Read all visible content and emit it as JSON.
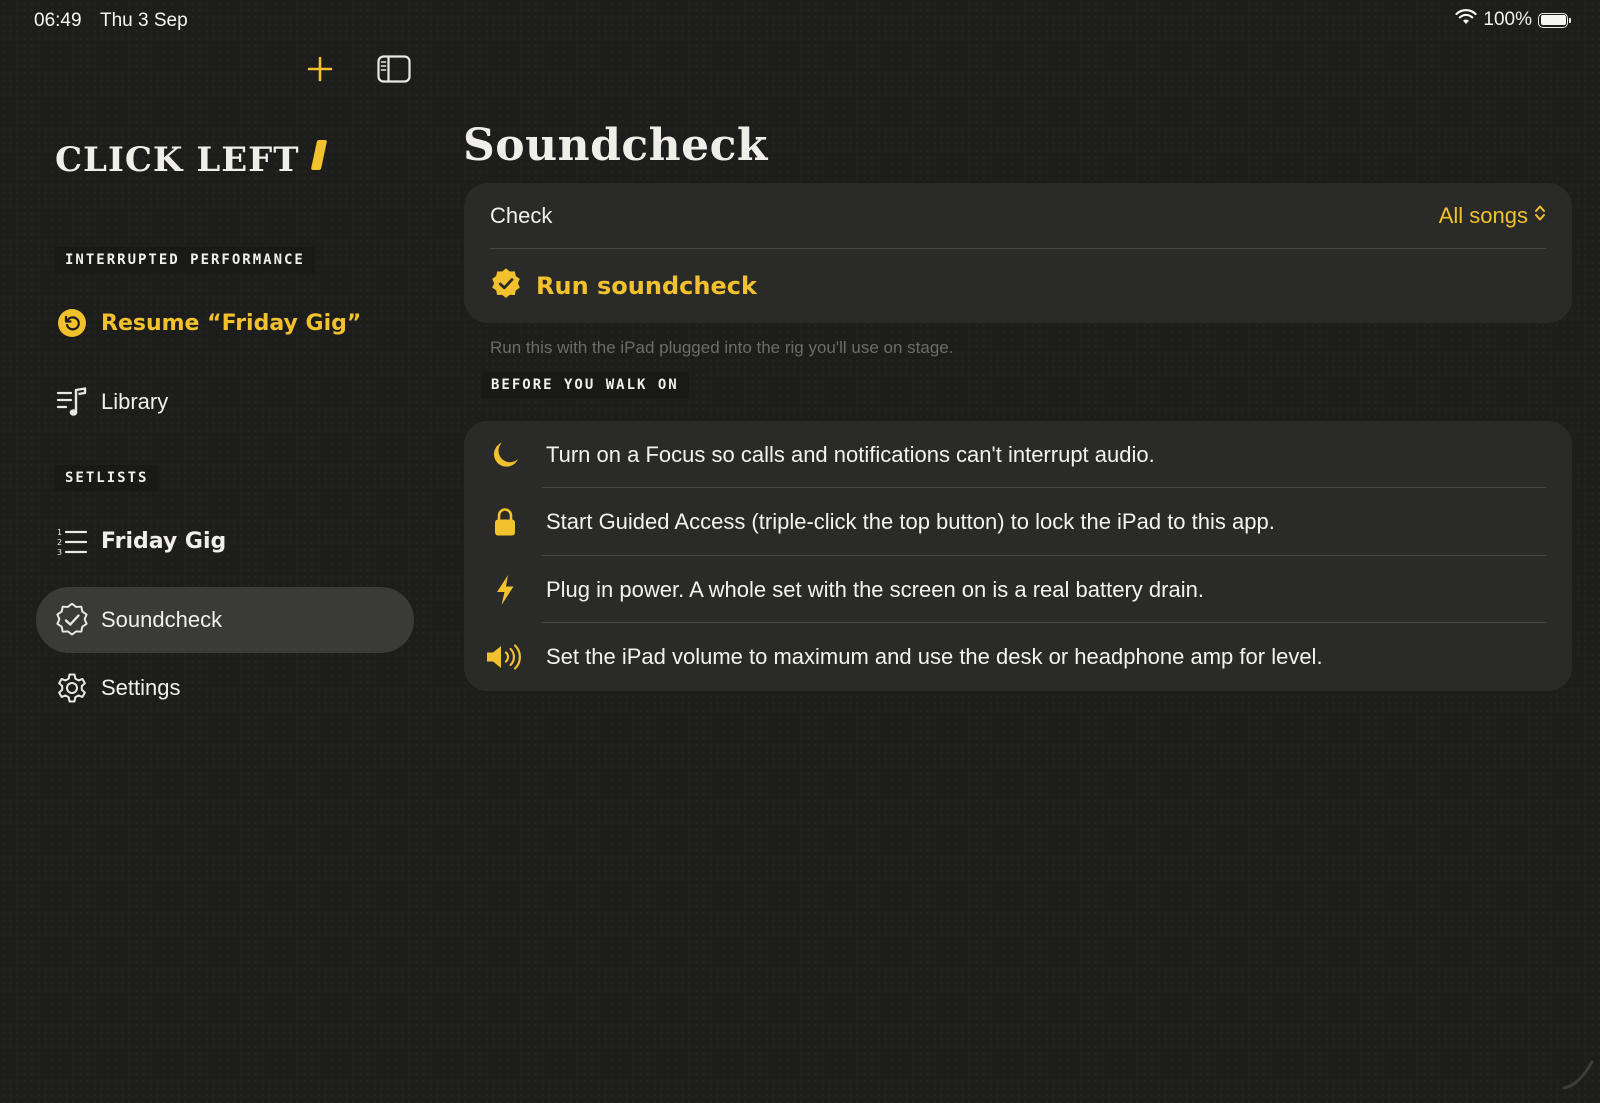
{
  "status_bar": {
    "time": "06:49",
    "date": "Thu 3 Sep",
    "battery": "100%",
    "battery_level": 1.0,
    "icons": [
      "wifi-icon",
      "battery-icon"
    ]
  },
  "toolbar": {
    "add_icon": "plus-icon",
    "sidebar_toggle_icon": "sidebar-icon"
  },
  "sidebar": {
    "brand": "CLICK LEFT",
    "interrupted_section": "INTERRUPTED PERFORMANCE",
    "resume_label": "Resume “Friday Gig”",
    "library_label": "Library",
    "setlists_section": "SETLISTS",
    "setlist_item": "Friday Gig",
    "soundcheck_label": "Soundcheck",
    "settings_label": "Settings"
  },
  "main": {
    "title": "Soundcheck",
    "check_label": "Check",
    "check_value": "All songs",
    "run_label": "Run soundcheck",
    "footnote": "Run this with the iPad plugged into the rig you'll use on stage.",
    "before_section": "BEFORE YOU WALK ON",
    "tips": [
      {
        "icon": "moon-icon",
        "text": "Turn on a Focus so calls and notifications can't interrupt audio."
      },
      {
        "icon": "lock-icon",
        "text": "Start Guided Access (triple-click the top button) to lock the iPad to this app."
      },
      {
        "icon": "bolt-icon",
        "text": "Plug in power. A whole set with the screen on is a real battery drain."
      },
      {
        "icon": "speaker-icon",
        "text": "Set the iPad volume to maximum and use the desk or headphone amp for level."
      }
    ]
  },
  "colors": {
    "accent": "#f2c12e",
    "background": "#1d1d1c",
    "card": "#2a2a28",
    "selected": "#3a3a38"
  }
}
